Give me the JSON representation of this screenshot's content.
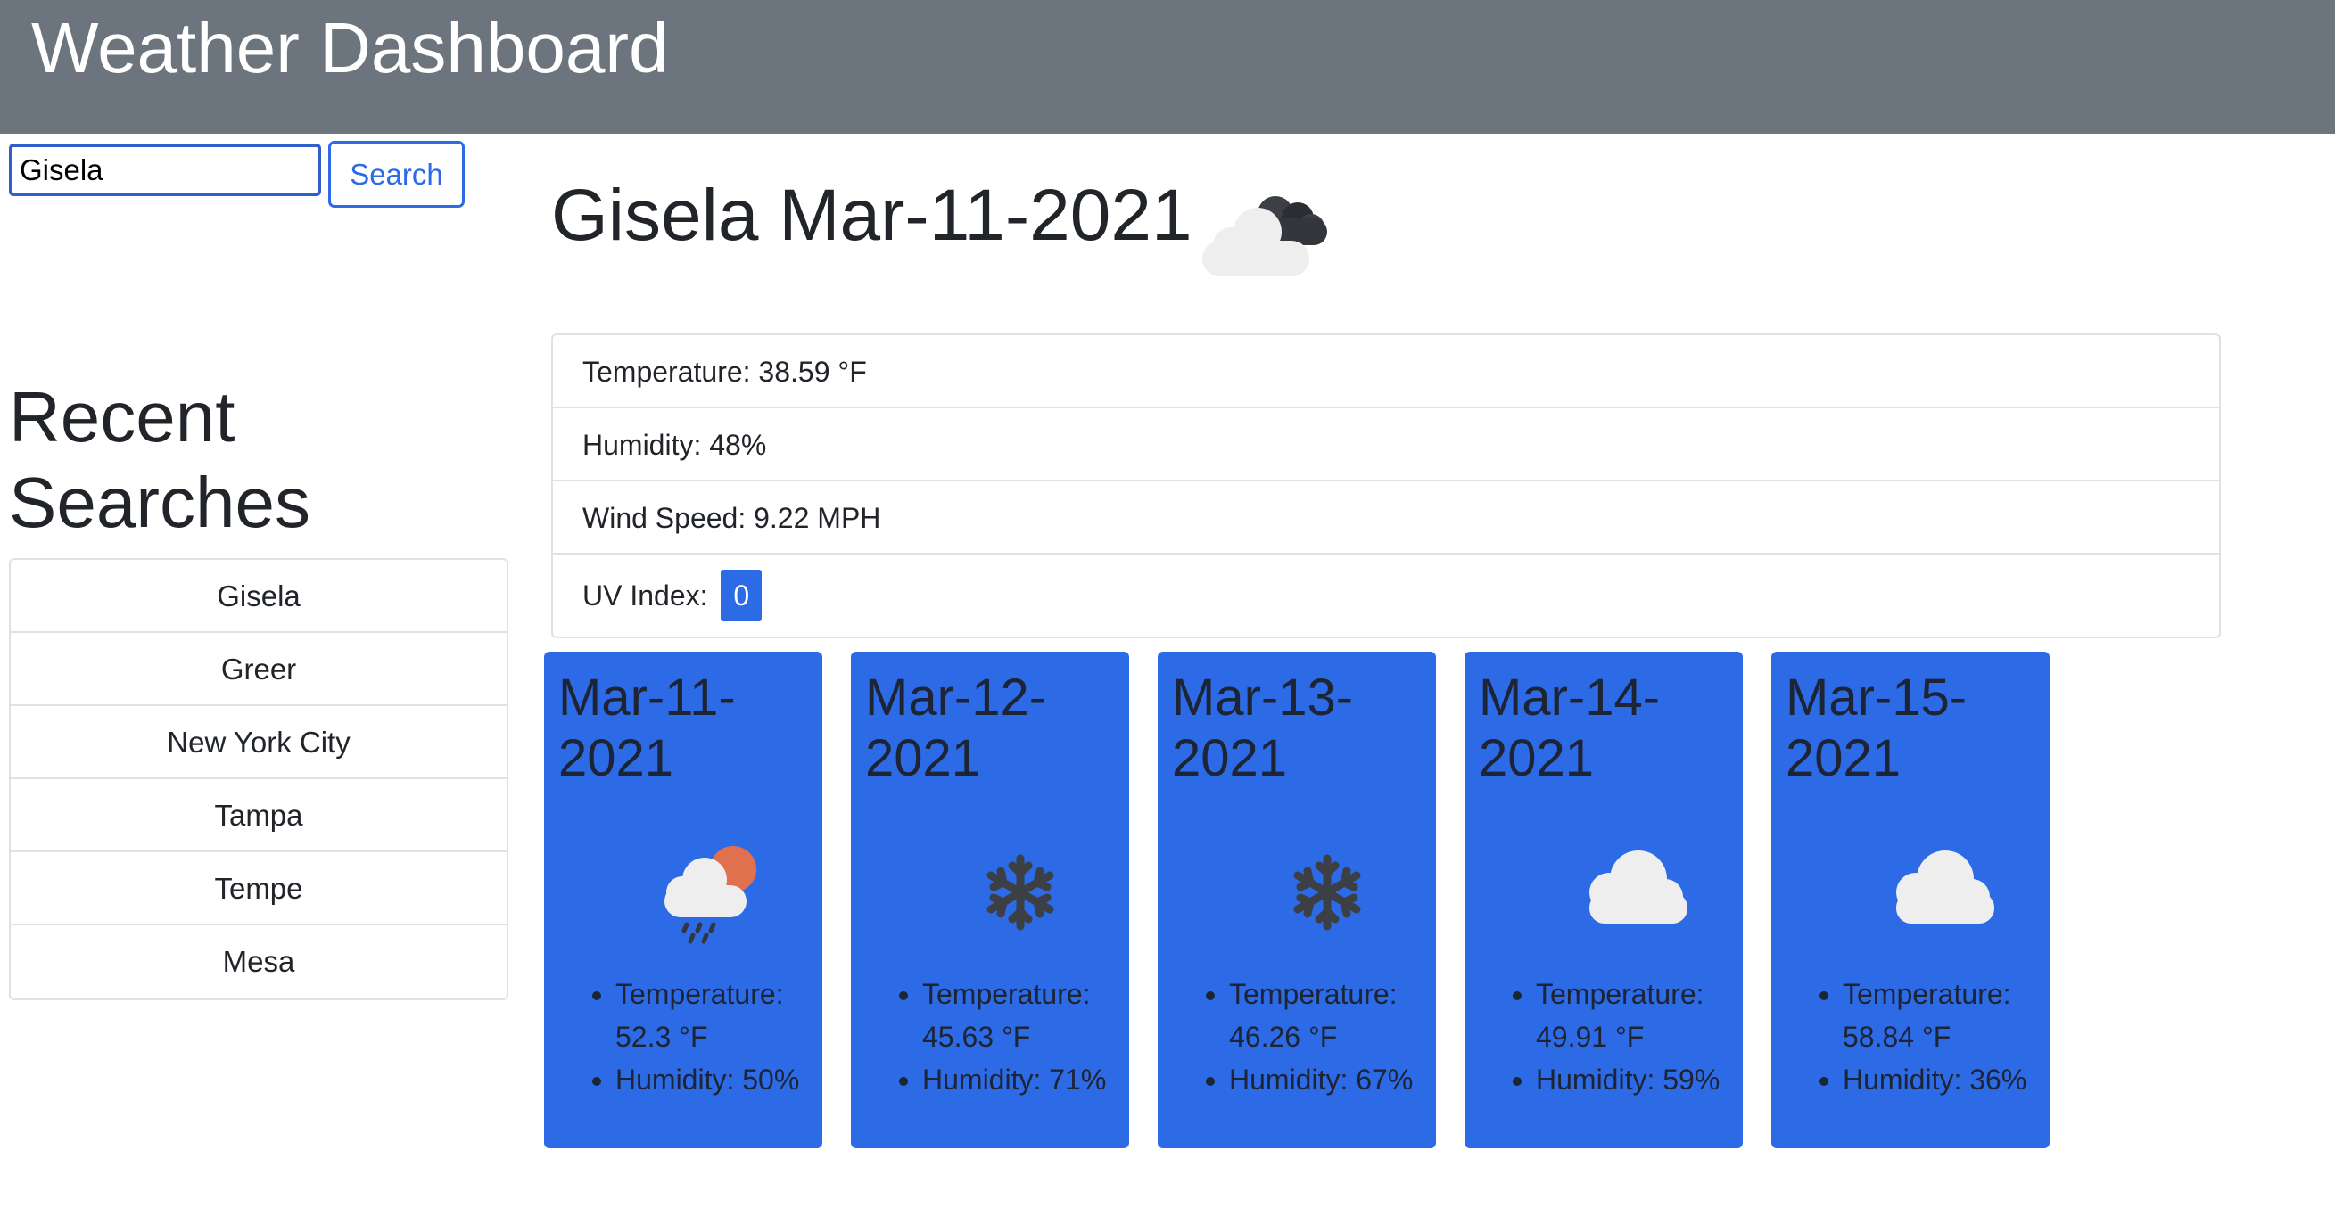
{
  "app": {
    "title": "Weather Dashboard"
  },
  "search": {
    "value": "Gisela",
    "button_label": "Search"
  },
  "recent": {
    "title": "Recent Searches",
    "items": [
      "Gisela",
      "Greer",
      "New York City",
      "Tampa",
      "Tempe",
      "Mesa"
    ]
  },
  "current": {
    "heading": "Gisela Mar-11-2021",
    "icon": "cloudy-icon",
    "temperature": "Temperature: 38.59 °F",
    "humidity": "Humidity: 48%",
    "wind": "Wind Speed: 9.22 MPH",
    "uv_label": "UV Index:",
    "uv_value": "0"
  },
  "forecast": [
    {
      "date": "Mar-11-2021",
      "icon": "sun-rain-icon",
      "temp": "Temperature: 52.3 °F",
      "humidity": "Humidity: 50%"
    },
    {
      "date": "Mar-12-2021",
      "icon": "snowflake-icon",
      "temp": "Temperature: 45.63 °F",
      "humidity": "Humidity: 71%"
    },
    {
      "date": "Mar-13-2021",
      "icon": "snowflake-icon",
      "temp": "Temperature: 46.26 °F",
      "humidity": "Humidity: 67%"
    },
    {
      "date": "Mar-14-2021",
      "icon": "cloud-icon",
      "temp": "Temperature: 49.91 °F",
      "humidity": "Humidity: 59%"
    },
    {
      "date": "Mar-15-2021",
      "icon": "cloud-icon",
      "temp": "Temperature: 58.84 °F",
      "humidity": "Humidity: 36%"
    }
  ],
  "colors": {
    "header": "#6c757d",
    "primary": "#2d6ae6",
    "border": "#dee2e6"
  }
}
